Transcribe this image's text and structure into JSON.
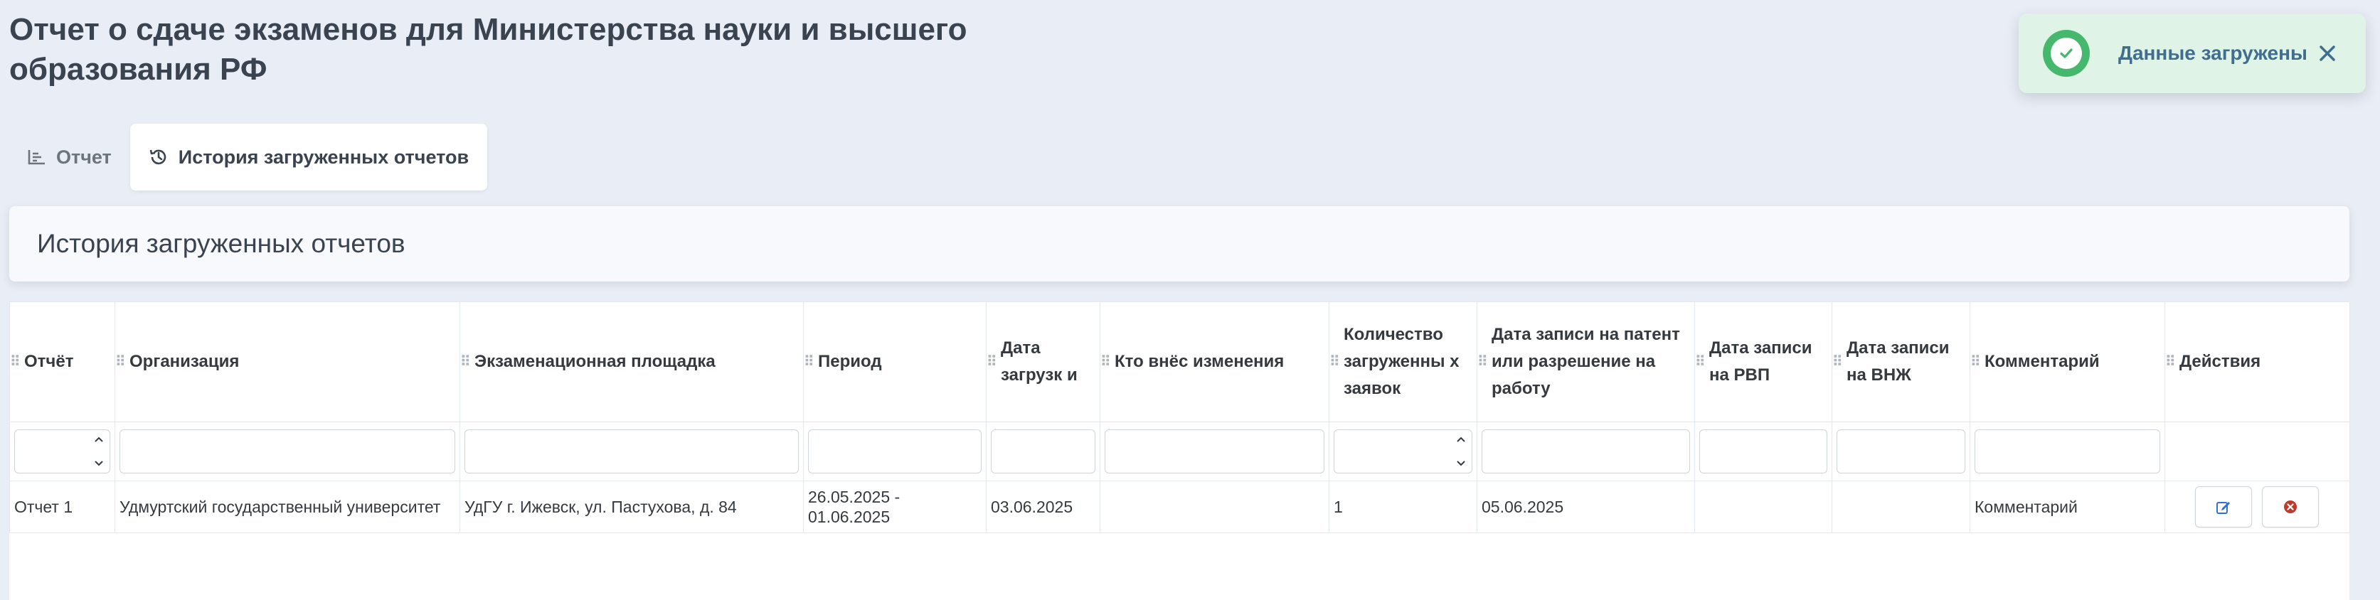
{
  "page": {
    "title": "Отчет о сдаче экзаменов для Министерства науки и высшего образования РФ"
  },
  "toast": {
    "message": "Данные загружены",
    "status_color": "#46b86e"
  },
  "tabs": [
    {
      "label": "Отчет",
      "icon": "bar-chart-icon",
      "active": false
    },
    {
      "label": "История загруженных отчетов",
      "icon": "history-icon",
      "active": true
    }
  ],
  "card": {
    "title": "История загруженных отчетов"
  },
  "table": {
    "columns": [
      "Отчёт",
      "Организация",
      "Экзаменационная площадка",
      "Период",
      "Дата загрузк и",
      "Кто внёс изменения",
      "Количество загруженны х заявок",
      "Дата записи на патент или разрешение на работу",
      "Дата записи на РВП",
      "Дата записи на ВНЖ",
      "Комментарий",
      "Действия"
    ],
    "rows": [
      {
        "report": "Отчет 1",
        "organization": "Удмуртский государственный университет",
        "site": "УдГУ г. Ижевск, ул. Пастухова, д. 84",
        "period": "26.05.2025 - 01.06.2025",
        "upload_date": "03.06.2025",
        "changed_by": "",
        "count": "1",
        "patent_date": "05.06.2025",
        "rvp_date": "",
        "vnzh_date": "",
        "comment": "Комментарий"
      }
    ]
  }
}
